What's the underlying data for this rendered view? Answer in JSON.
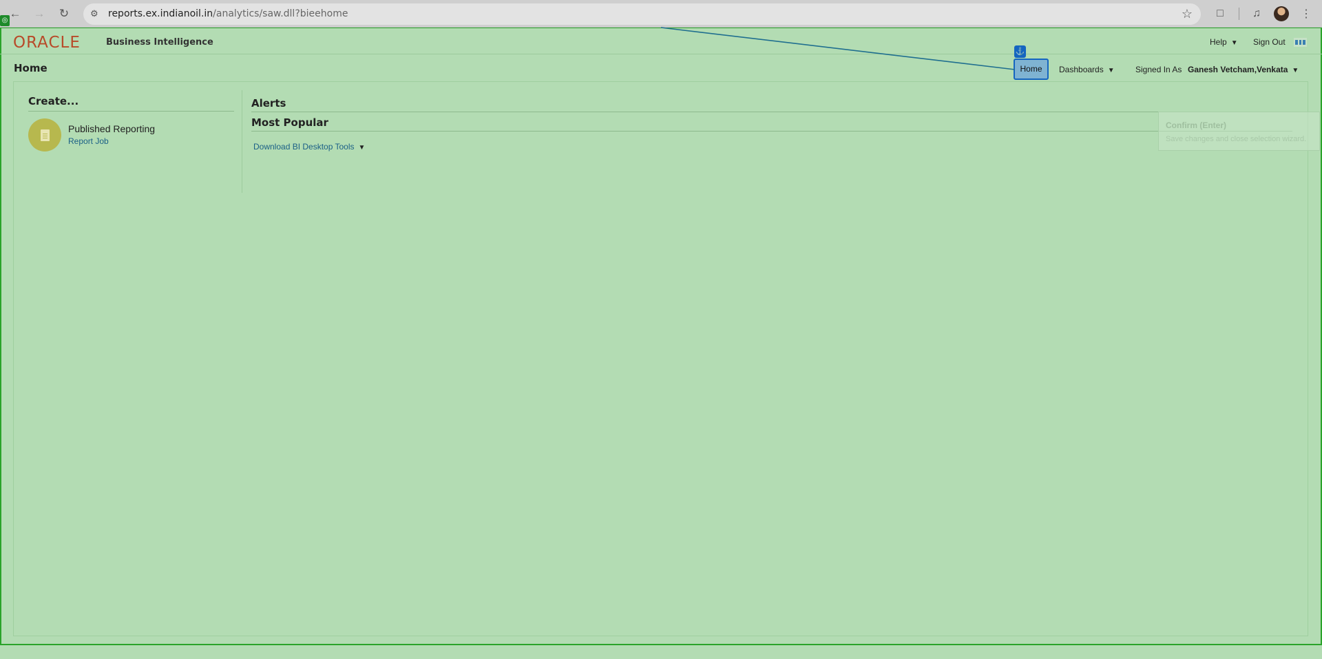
{
  "browser": {
    "url_host": "reports.ex.indianoil.in",
    "url_path": "/analytics/saw.dll?bieehome"
  },
  "header": {
    "logo": "ORACLE",
    "product": "Business Intelligence",
    "help_label": "Help",
    "signout_label": "Sign Out"
  },
  "nav": {
    "page_title": "Home",
    "home_label": "Home",
    "dashboards_label": "Dashboards",
    "signed_in_label": "Signed In As",
    "user_name": "Ganesh Vetcham,Venkata"
  },
  "create": {
    "heading": "Create...",
    "item_title": "Published Reporting",
    "item_link": "Report Job"
  },
  "alerts": {
    "heading": "Alerts"
  },
  "popular": {
    "heading": "Most Popular",
    "download_label": "Download BI Desktop Tools"
  },
  "tooltip": {
    "title": "Confirm (Enter)",
    "subtitle": "Save changes and close selection wizard."
  },
  "colors": {
    "overlay_green": "#b3dcb3",
    "oracle_red": "#b84a29",
    "highlight_blue": "#1565c0",
    "link_blue": "#1a5f86"
  }
}
